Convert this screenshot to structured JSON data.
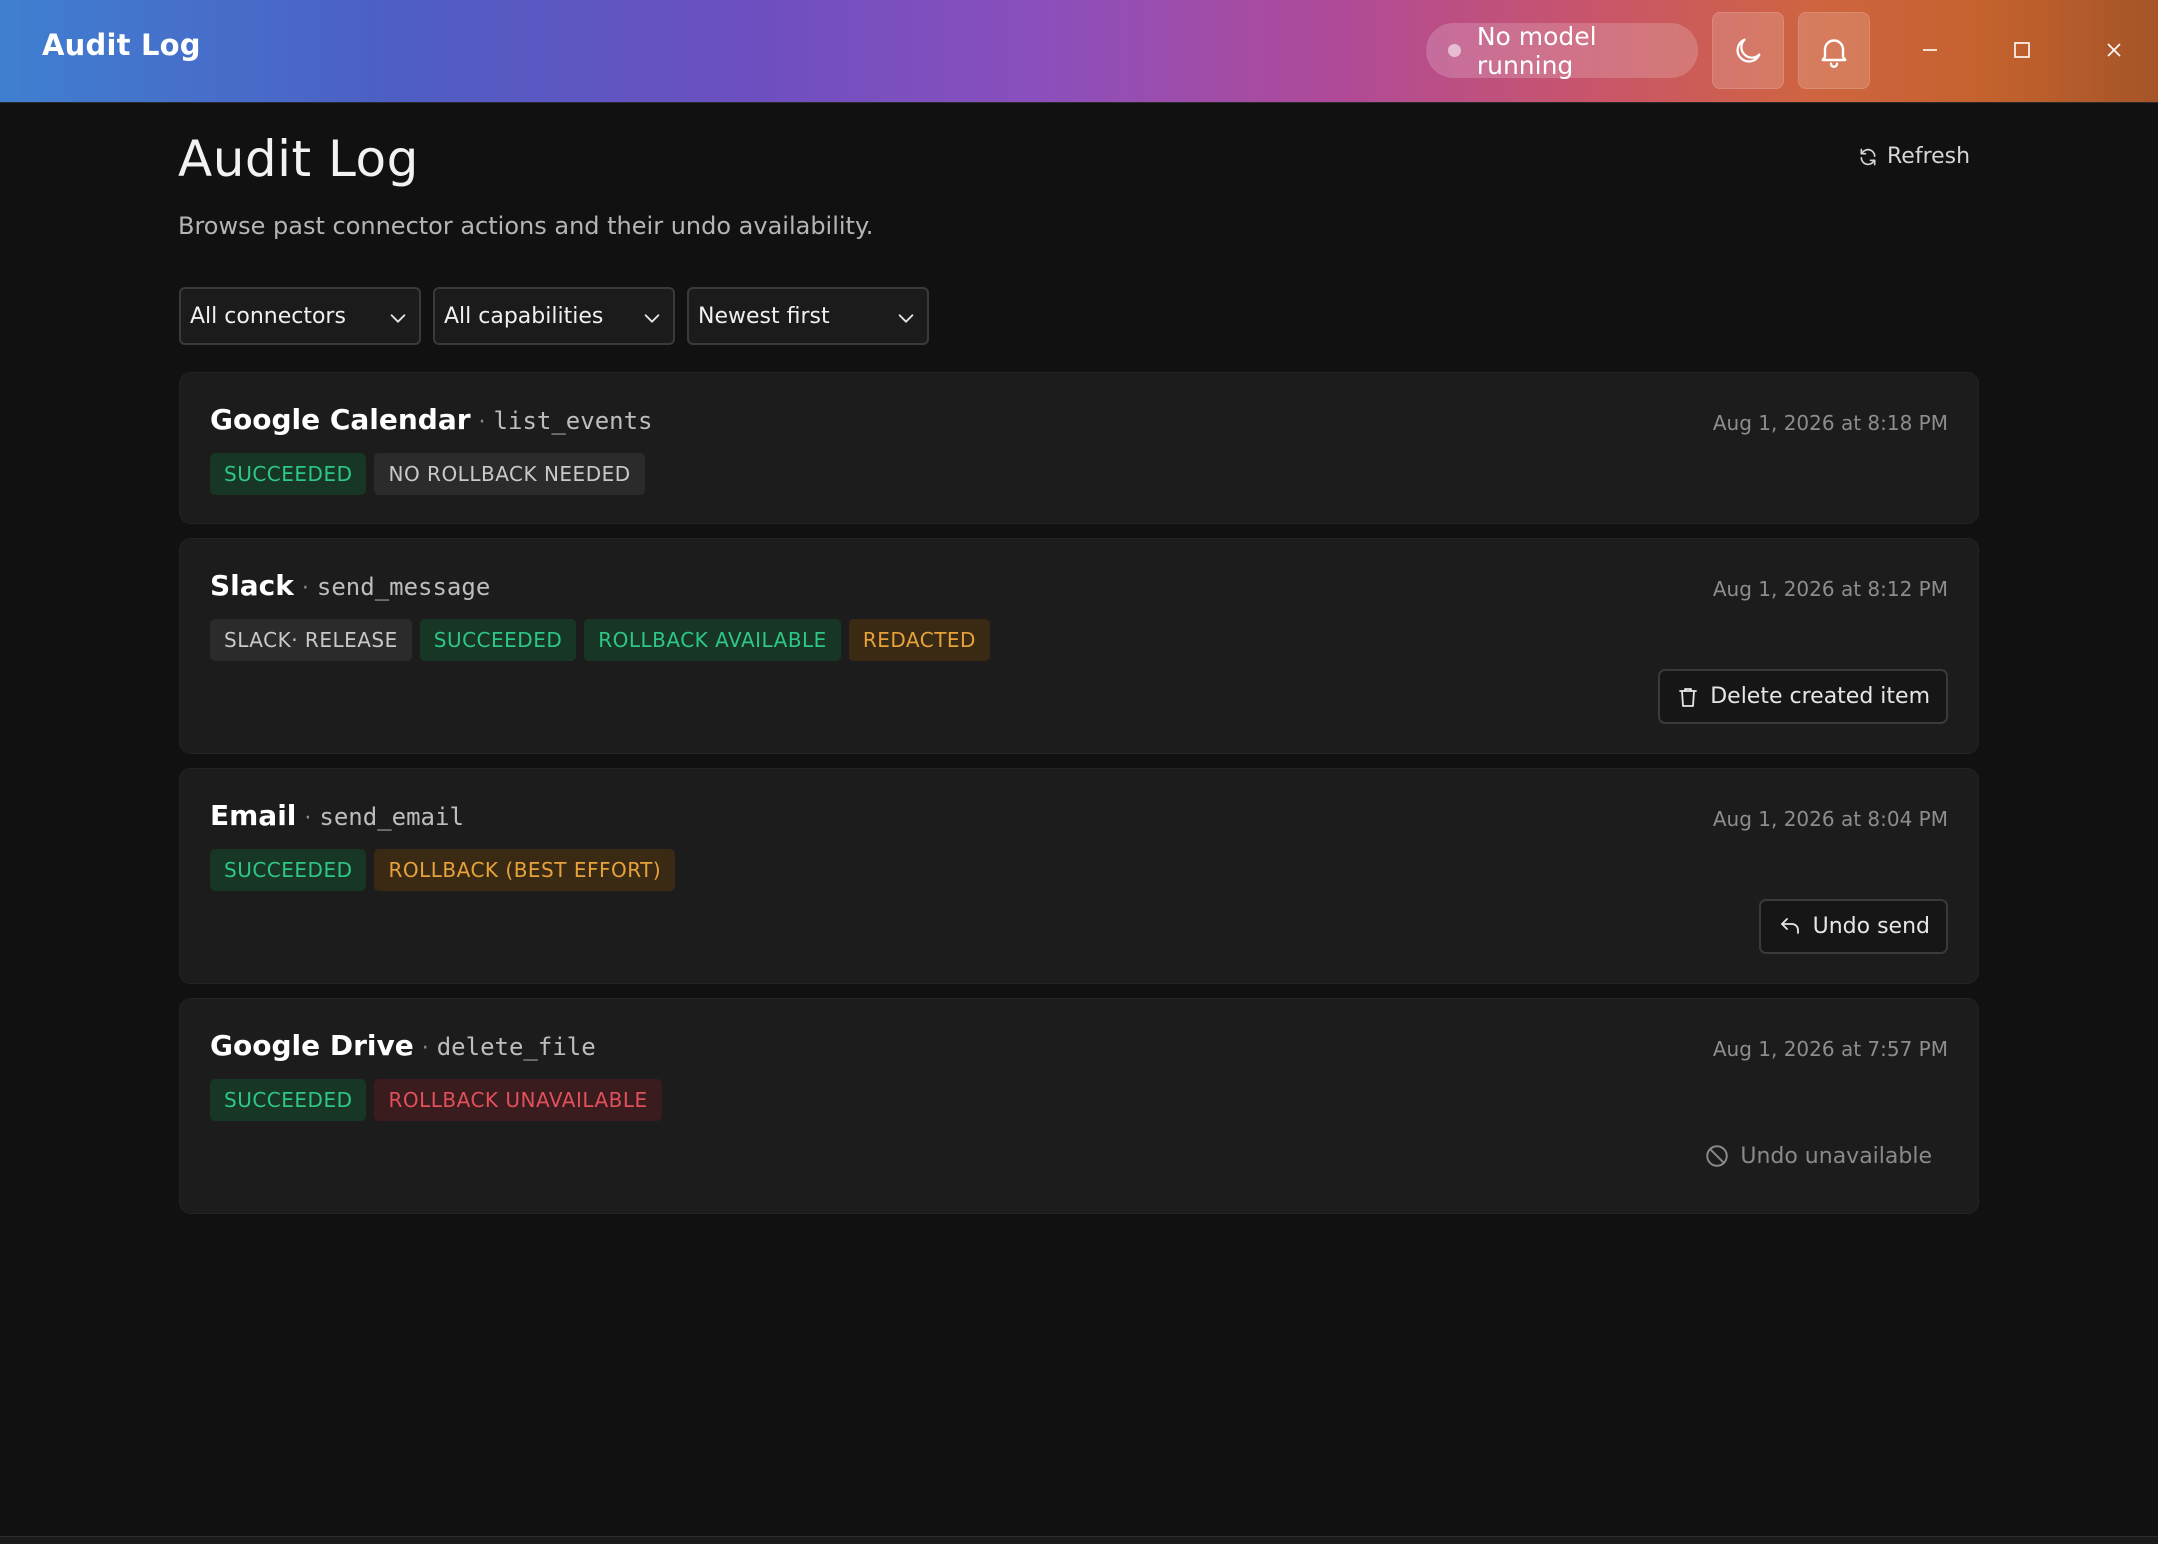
{
  "window": {
    "app_title": "Audit Log",
    "model_status": "No model running",
    "theme_icon": "moon-icon",
    "notifications_icon": "bell-icon",
    "gradient_colors": [
      "#3f7fd0",
      "#6b4fc0",
      "#b04a98",
      "#cf6440",
      "#a55428"
    ]
  },
  "page": {
    "title": "Audit Log",
    "subtitle": "Browse past connector actions and their undo availability.",
    "refresh_label": "Refresh"
  },
  "filters": {
    "connector": "All connectors",
    "capability": "All capabilities",
    "sort": "Newest first"
  },
  "entries": [
    {
      "connector": "Google Calendar",
      "capability": "list_events",
      "timestamp": "Aug 1, 2026 at 8:18 PM",
      "badges": [
        "SUCCEEDED",
        "NO ROLLBACK NEEDED"
      ]
    },
    {
      "connector": "Slack",
      "capability": "send_message",
      "timestamp": "Aug 1, 2026 at 8:12 PM",
      "badges": [
        "SLACK· RELEASE",
        "SUCCEEDED",
        "ROLLBACK AVAILABLE",
        "REDACTED"
      ],
      "action": "Delete created item"
    },
    {
      "connector": "Email",
      "capability": "send_email",
      "timestamp": "Aug 1, 2026 at 8:04 PM",
      "badges": [
        "SUCCEEDED",
        "ROLLBACK (BEST EFFORT)"
      ],
      "action": "Undo send"
    },
    {
      "connector": "Google Drive",
      "capability": "delete_file",
      "timestamp": "Aug 1, 2026 at 7:57 PM",
      "badges": [
        "SUCCEEDED",
        "ROLLBACK UNAVAILABLE"
      ],
      "action": "Undo unavailable"
    }
  ],
  "colors": {
    "success": "#2ec785",
    "neutral": "#c9c9c9",
    "warning": "#e7a23a",
    "danger": "#e2505a",
    "background": "#111111",
    "card": "#1c1c1c"
  }
}
